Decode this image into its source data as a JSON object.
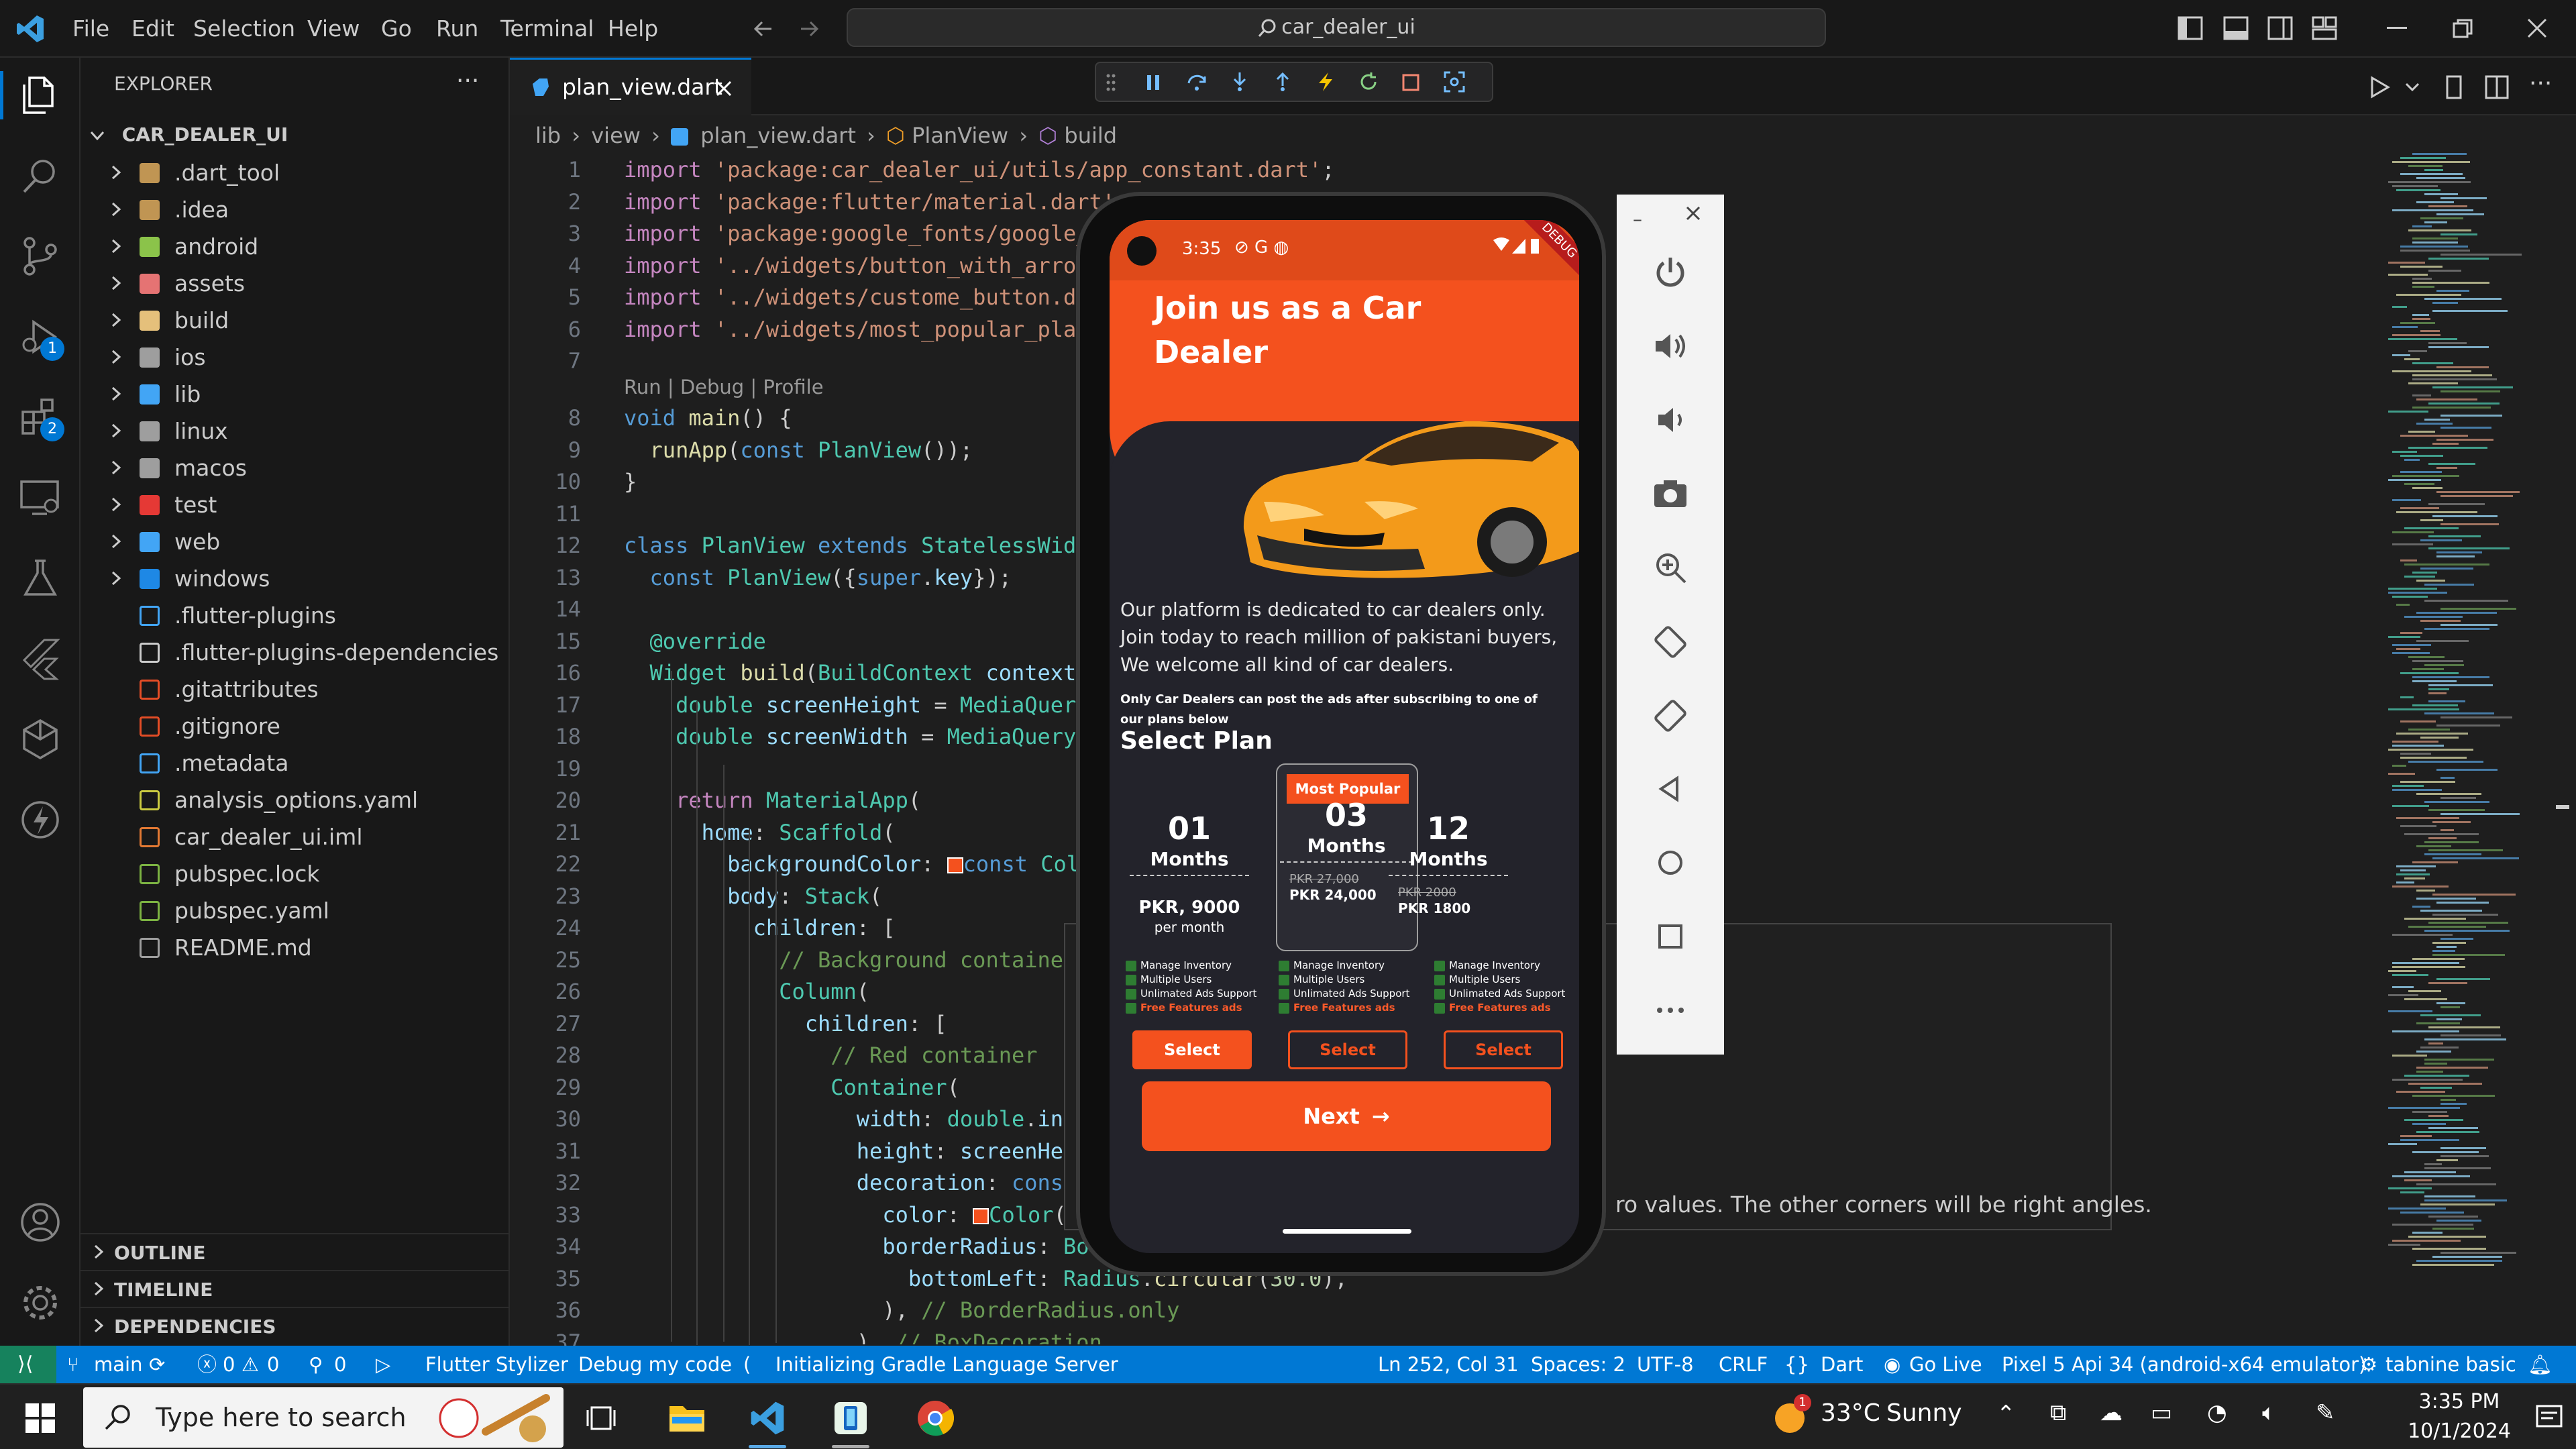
{
  "menu": [
    "File",
    "Edit",
    "Selection",
    "View",
    "Go",
    "Run",
    "Terminal",
    "Help"
  ],
  "search_text": "car_dealer_ui",
  "explorer": {
    "title": "EXPLORER",
    "project": "CAR_DEALER_UI",
    "items": [
      {
        "label": ".dart_tool",
        "folder": true,
        "color": "#c09553"
      },
      {
        "label": ".idea",
        "folder": true,
        "color": "#c09553"
      },
      {
        "label": "android",
        "folder": true,
        "color": "#8bc34a"
      },
      {
        "label": "assets",
        "folder": true,
        "color": "#e57373"
      },
      {
        "label": "build",
        "folder": true,
        "color": "#e5c07b"
      },
      {
        "label": "ios",
        "folder": true,
        "color": "#9e9e9e"
      },
      {
        "label": "lib",
        "folder": true,
        "color": "#42a5f5"
      },
      {
        "label": "linux",
        "folder": true,
        "color": "#9e9e9e"
      },
      {
        "label": "macos",
        "folder": true,
        "color": "#9e9e9e"
      },
      {
        "label": "test",
        "folder": true,
        "color": "#e53935"
      },
      {
        "label": "web",
        "folder": true,
        "color": "#42a5f5"
      },
      {
        "label": "windows",
        "folder": true,
        "color": "#1e88e5"
      },
      {
        "label": ".flutter-plugins",
        "folder": false,
        "color": "#42a5f5"
      },
      {
        "label": ".flutter-plugins-dependencies",
        "folder": false,
        "color": "#cccccc"
      },
      {
        "label": ".gitattributes",
        "folder": false,
        "color": "#e44d26"
      },
      {
        "label": ".gitignore",
        "folder": false,
        "color": "#e44d26"
      },
      {
        "label": ".metadata",
        "folder": false,
        "color": "#42a5f5"
      },
      {
        "label": "analysis_options.yaml",
        "folder": false,
        "color": "#cbcb41"
      },
      {
        "label": "car_dealer_ui.iml",
        "folder": false,
        "color": "#e37933"
      },
      {
        "label": "pubspec.lock",
        "folder": false,
        "color": "#7cb342"
      },
      {
        "label": "pubspec.yaml",
        "folder": false,
        "color": "#7cb342"
      },
      {
        "label": "README.md",
        "folder": false,
        "color": "#9e9e9e"
      }
    ],
    "sections": [
      "OUTLINE",
      "TIMELINE",
      "DEPENDENCIES"
    ]
  },
  "badges": {
    "debug": "1",
    "extensions": "2"
  },
  "tab": {
    "label": "plan_view.dart"
  },
  "breadcrumbs": [
    "lib",
    "view",
    "plan_view.dart",
    "PlanView",
    "build"
  ],
  "code": {
    "codelens": "Run | Debug | Profile",
    "line_numbers": [
      "1",
      "2",
      "3",
      "4",
      "5",
      "6",
      "7",
      "8",
      "9",
      "10",
      "11",
      "12",
      "13",
      "14",
      "15",
      "16",
      "17",
      "18",
      "19",
      "20",
      "21",
      "22",
      "23",
      "24",
      "25",
      "26",
      "27",
      "28",
      "29",
      "30",
      "31",
      "32",
      "33",
      "34",
      "35",
      "36",
      "37"
    ]
  },
  "tooltip_text": "ro values. The other corners will be right angles.",
  "phone": {
    "time": "3:35",
    "debug_ribbon": "DEBUG",
    "headline": "Join us as a Car Dealer",
    "intro": "Our platform is dedicated to car dealers only. Join today to reach million of pakistani buyers, We welcome all kind of car dealers.",
    "note": "Only Car Dealers can post the ads after subscribing to one of our plans below",
    "select_plan": "Select Plan",
    "popular_badge": "Most Popular",
    "plans": [
      {
        "num": "01",
        "unit": "Months",
        "old": "",
        "price": "PKR, 9000",
        "per": "per month"
      },
      {
        "num": "03",
        "unit": "Months",
        "old": "PKR 27,000",
        "price": "PKR 24,000",
        "per": ""
      },
      {
        "num": "12",
        "unit": "Months",
        "old": "PKR 2000",
        "price": "PKR 1800",
        "per": ""
      }
    ],
    "features": [
      "Manage Inventory",
      "Multiple Users",
      "Unlimated Ads Support",
      "Free Features ads"
    ],
    "select_label": "Select",
    "next_label": "Next"
  },
  "statusbar": {
    "branch": "main",
    "errors": "0",
    "warnings": "0",
    "ports": "0",
    "flutter_stylizer": "Flutter Stylizer",
    "debug_code": "Debug my code",
    "gradle": "Initializing Gradle Language Server",
    "position": "Ln 252, Col 31",
    "spaces": "Spaces: 2",
    "encoding": "UTF-8",
    "eol": "CRLF",
    "language": "Dart",
    "golive": "Go Live",
    "device": "Pixel 5 Api 34 (android-x64 emulator)",
    "tabnine": "tabnine basic"
  },
  "taskbar": {
    "search_placeholder": "Type here to search",
    "weather_temp": "33°C",
    "weather_desc": "Sunny",
    "weather_badge": "1",
    "time": "3:35 PM",
    "date": "10/1/2024"
  },
  "colors": {
    "accent": "#0078d4",
    "brand_orange": "#f4511e"
  }
}
